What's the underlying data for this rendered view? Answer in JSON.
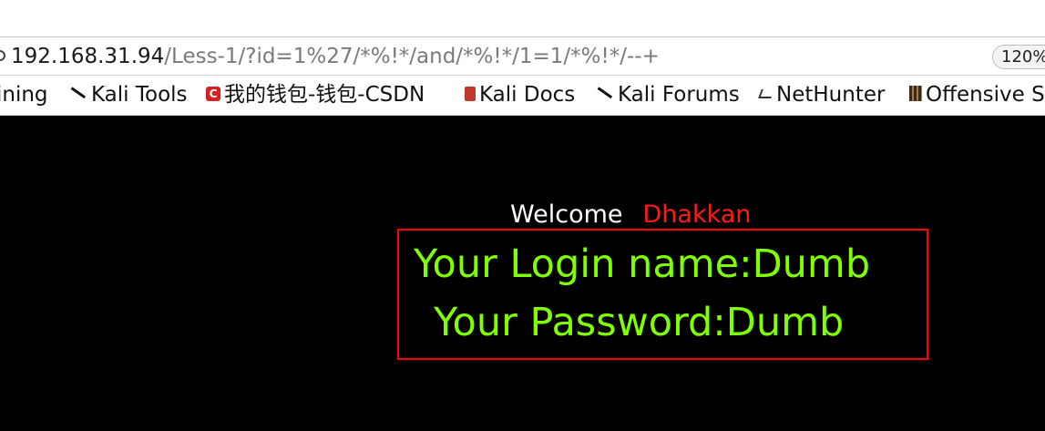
{
  "browser": {
    "address_host": "192.168.31.94",
    "address_path": "/Less-1/?id=1%27/*%!*/and/*%!*/1=1/*%!*/--+",
    "zoom_level": "120%"
  },
  "bookmarks": [
    {
      "label": "ining",
      "icon": "none"
    },
    {
      "label": "Kali Tools",
      "icon": "kali-dragon-icon"
    },
    {
      "label": "我的钱包-钱包-CSDN",
      "icon": "csdn-icon"
    },
    {
      "label": "Kali Docs",
      "icon": "kali-docs-icon"
    },
    {
      "label": "Kali Forums",
      "icon": "kali-dragon-icon"
    },
    {
      "label": "NetHunter",
      "icon": "nethunter-icon"
    },
    {
      "label": "Offensive S",
      "icon": "offensive-security-icon"
    }
  ],
  "page": {
    "welcome_word": "Welcome",
    "welcome_name": "Dhakkan",
    "login_line": "Your Login name:Dumb",
    "password_line": "Your Password:Dumb"
  },
  "colors": {
    "background": "#000000",
    "welcome_name": "#ff1a1a",
    "result_text": "#7fff00",
    "result_border": "#ff0000"
  }
}
